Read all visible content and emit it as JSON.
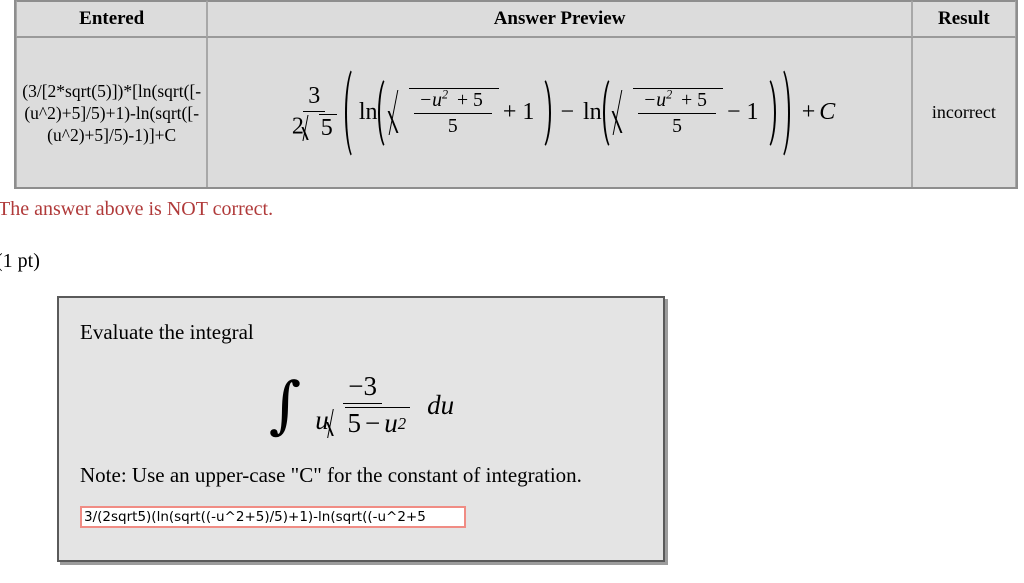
{
  "result_table": {
    "headers": [
      "Entered",
      "Answer Preview",
      "Result"
    ],
    "row": {
      "entered": "(3/[2*sqrt(5)])*[ln(sqrt([-(u^2)+5]/5)+1)-ln(sqrt([-(u^2)+5]/5)-1)]+C",
      "answer_preview_text": "3/(2√5) ( ln( √((−u²+5)/5) + 1 ) − ln( √((−u²+5)/5) − 1 ) ) + C",
      "result": "incorrect"
    },
    "preview_parts": {
      "coef_num": "3",
      "coef_den_2": "2",
      "coef_den_radicand": "5",
      "ln": "ln",
      "radicand_num_neg_u": "−u",
      "radicand_num_exp": "2",
      "radicand_num_plus5": "+ 5",
      "radicand_den": "5",
      "plus_one": "+ 1",
      "minus_between": "−",
      "minus_one": "− 1",
      "plus_c_op": "+",
      "plus_c_var": "C"
    }
  },
  "feedback": {
    "message": "The answer above is NOT correct.",
    "color": "#b03a3a"
  },
  "points": {
    "label": "(1 pt)"
  },
  "problem": {
    "prompt": "Evaluate the integral",
    "integral": {
      "sign": "∫",
      "numerator": "−3",
      "den_u": "u",
      "den_radicand_5": "5",
      "den_radicand_minus": "−",
      "den_radicand_u": "u",
      "den_radicand_exp": "2",
      "differential": "du",
      "plain_text": "∫ −3 / ( u√(5 − u²) ) du"
    },
    "note": "Note: Use an upper-case \"C\" for the constant of integration.",
    "answer_field": {
      "value": "3/(2sqrt5)(ln(sqrt((-u^2+5)/5)+1)-ln(sqrt((-u^2+5",
      "placeholder": "",
      "border_color": "#f08c84",
      "state": "invalid"
    }
  }
}
